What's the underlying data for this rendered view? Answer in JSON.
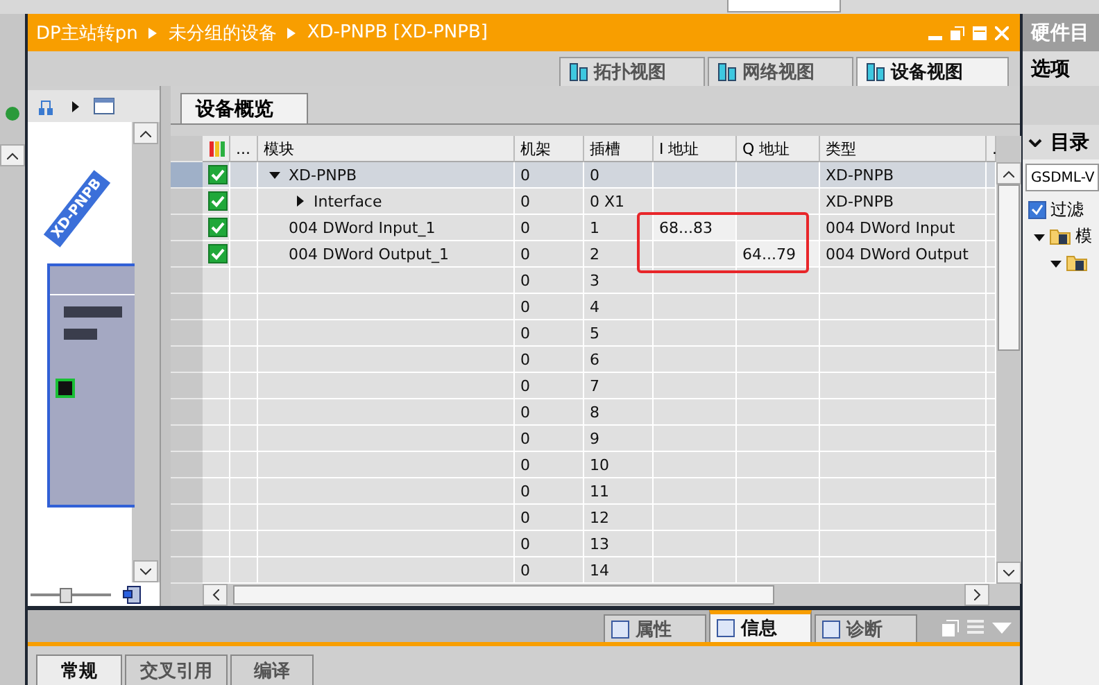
{
  "breadcrumb": [
    "DP主站转pn",
    "未分组的设备",
    "XD-PNPB [XD-PNPB]"
  ],
  "view_tabs": [
    {
      "label": "拓扑视图",
      "selected": false
    },
    {
      "label": "网络视图",
      "selected": false
    },
    {
      "label": "设备视图",
      "selected": true
    }
  ],
  "device_pane": {
    "device_label": "XD-PNPB",
    "zoom": {
      "level": 0.43
    }
  },
  "overview_tab": "设备概览",
  "table": {
    "columns": [
      "...",
      "模块",
      "机架",
      "插槽",
      "I 地址",
      "Q 地址",
      "类型",
      "."
    ],
    "rows": [
      {
        "status_ok": true,
        "selected": true,
        "module": "XD-PNPB",
        "expanded": true,
        "rack": "0",
        "slot": "0",
        "i_address": "",
        "q_address": "",
        "type": "XD-PNPB",
        "children": [
          {
            "status_ok": true,
            "selected": false,
            "module": "Interface",
            "expanded": false,
            "rack": "0",
            "slot": "0 X1",
            "type": "XD-PNPB"
          }
        ]
      },
      {
        "status_ok": true,
        "selected": false,
        "module": "004 DWord Input_1",
        "rack": "0",
        "slot": "1",
        "i_address": "68...83",
        "type": "004 DWord Input"
      },
      {
        "status_ok": true,
        "selected": false,
        "module": "004 DWord Output_1",
        "rack": "0",
        "slot": "2",
        "q_address": "64...79",
        "type": "004 DWord Output"
      },
      {
        "status_ok": false,
        "selected": false,
        "rack": "0",
        "slot": "3"
      },
      {
        "status_ok": false,
        "selected": false,
        "rack": "0",
        "slot": "4"
      },
      {
        "status_ok": false,
        "selected": false,
        "rack": "0",
        "slot": "5"
      },
      {
        "status_ok": false,
        "selected": false,
        "rack": "0",
        "slot": "6"
      },
      {
        "status_ok": false,
        "selected": false,
        "rack": "0",
        "slot": "7"
      },
      {
        "status_ok": false,
        "selected": false,
        "rack": "0",
        "slot": "8"
      },
      {
        "status_ok": false,
        "selected": false,
        "rack": "0",
        "slot": "9"
      },
      {
        "status_ok": false,
        "selected": false,
        "rack": "0",
        "slot": "10"
      },
      {
        "status_ok": false,
        "selected": false,
        "rack": "0",
        "slot": "11"
      },
      {
        "status_ok": false,
        "selected": false,
        "rack": "0",
        "slot": "12"
      },
      {
        "status_ok": false,
        "selected": false,
        "rack": "0",
        "slot": "13"
      },
      {
        "status_ok": false,
        "selected": false,
        "rack": "0",
        "slot": "14"
      }
    ]
  },
  "inspector_tabs": [
    {
      "label": "属性",
      "selected": false
    },
    {
      "label": "信息",
      "selected": true
    },
    {
      "label": "诊断",
      "selected": false
    }
  ],
  "inspector_subtabs": [
    {
      "label": "常规",
      "selected": true
    },
    {
      "label": "交叉引用",
      "selected": false
    },
    {
      "label": "编译",
      "selected": false
    }
  ],
  "catalog": {
    "title": "硬件目",
    "options": "选项",
    "section": "目录",
    "search_value": "GSDML-V",
    "filter": {
      "label": "过滤",
      "checked": true
    },
    "tree": [
      {
        "label": "模",
        "expanded": true
      }
    ]
  }
}
